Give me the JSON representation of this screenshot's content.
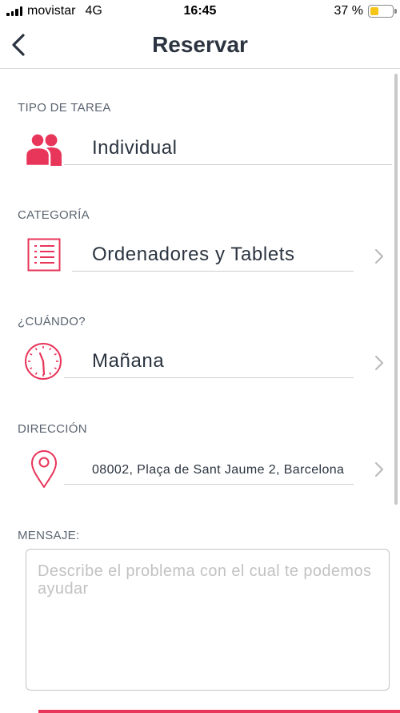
{
  "status_bar": {
    "carrier": "movistar",
    "network": "4G",
    "time": "16:45",
    "battery_percent_text": "37 %",
    "battery_level": 0.37
  },
  "header": {
    "title": "Reservar",
    "back_icon": "chevron-left-icon"
  },
  "form": {
    "task_type": {
      "label": "TIPO DE TAREA",
      "value": "Individual",
      "icon": "users-icon"
    },
    "category": {
      "label": "CATEGORÍA",
      "value": "Ordenadores y Tablets",
      "icon": "list-icon"
    },
    "when": {
      "label": "¿CUÁNDO?",
      "value": "Mañana",
      "icon": "clock-icon"
    },
    "address": {
      "label": "DIRECCIÓN",
      "value": "08002, Plaça de Sant Jaume 2, Barcelona",
      "icon": "location-pin-icon"
    },
    "message": {
      "label": "MENSAJE:",
      "placeholder": "Describe el problema con el cual te podemos ayudar",
      "value": ""
    }
  },
  "colors": {
    "accent": "#e8355a",
    "text": "#2b3440",
    "label": "#5a6470",
    "chevron": "#b8b8b8"
  }
}
